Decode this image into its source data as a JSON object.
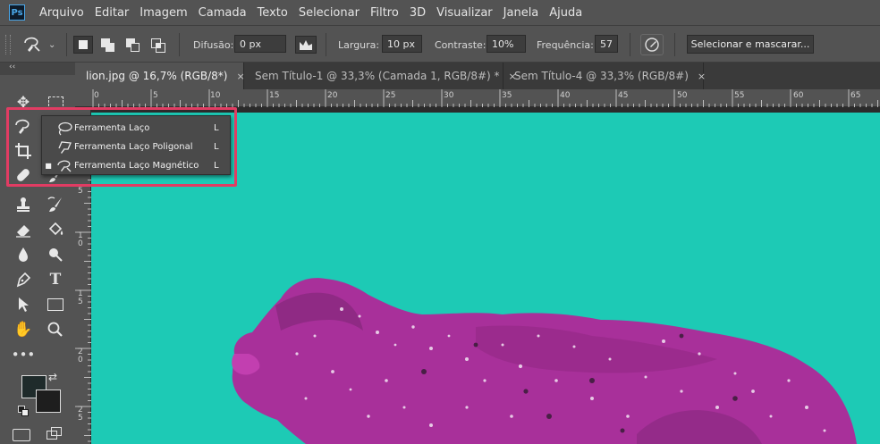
{
  "app_logo": "Ps",
  "menu": [
    "Arquivo",
    "Editar",
    "Imagem",
    "Camada",
    "Texto",
    "Selecionar",
    "Filtro",
    "3D",
    "Visualizar",
    "Janela",
    "Ajuda"
  ],
  "options_bar": {
    "feather_label": "Difusão:",
    "feather_value": "0 px",
    "width_label": "Largura:",
    "width_value": "10 px",
    "contrast_label": "Contraste:",
    "contrast_value": "10%",
    "frequency_label": "Frequência:",
    "frequency_value": "57",
    "select_mask_label": "Selecionar e mascarar..."
  },
  "tabs": [
    {
      "label": "lion.jpg @ 16,7% (RGB/8*)",
      "close": "×",
      "active": true
    },
    {
      "label": "Sem Título-1 @ 33,3% (Camada 1, RGB/8#) *",
      "close": "×",
      "active": false
    },
    {
      "label": "Sem Título-4 @ 33,3% (RGB/8#)",
      "close": "×",
      "active": false
    }
  ],
  "ruler_top": [
    "0",
    "5",
    "10",
    "15",
    "20",
    "25",
    "30",
    "35",
    "40",
    "45",
    "50",
    "55",
    "60",
    "65"
  ],
  "ruler_left": [
    "5",
    "1\n0",
    "1\n5",
    "2\n0",
    "2\n5"
  ],
  "flyout": [
    {
      "label": "Ferramenta Laço",
      "shortcut": "L",
      "selected": false,
      "icon": "lasso-icon"
    },
    {
      "label": "Ferramenta Laço Poligonal",
      "shortcut": "L",
      "selected": false,
      "icon": "polygonal-lasso-icon"
    },
    {
      "label": "Ferramenta Laço Magnético",
      "shortcut": "L",
      "selected": true,
      "icon": "magnetic-lasso-icon"
    }
  ],
  "toolbar_grip": "‹‹",
  "colors": {
    "highlight": "#e13c63",
    "canvas_background": "#1dcab5",
    "lion": "#a8309a"
  }
}
